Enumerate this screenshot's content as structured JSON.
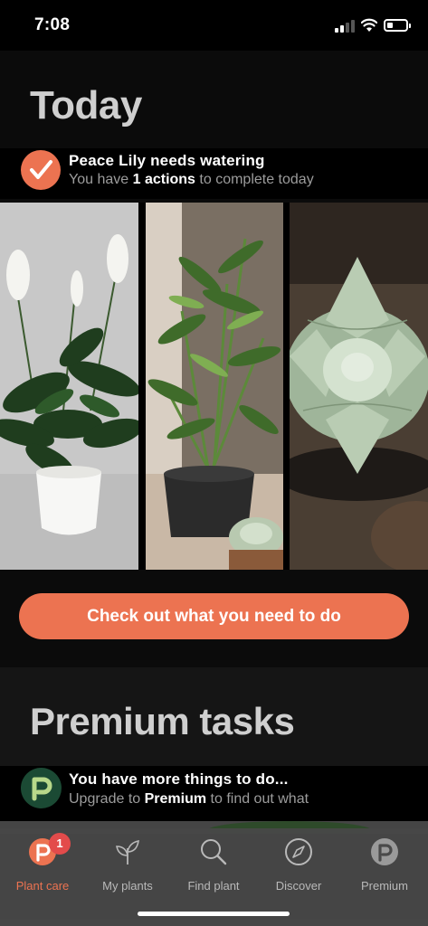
{
  "status_bar": {
    "time": "7:08"
  },
  "today": {
    "title": "Today",
    "task": {
      "title": "Peace Lily needs watering",
      "subtitle_prefix": "You have ",
      "subtitle_bold": "1 actions",
      "subtitle_suffix": " to complete today"
    },
    "photos": [
      "peace-lily-photo",
      "palm-plant-photo",
      "succulent-photo"
    ],
    "cta_label": "Check out what you need to do"
  },
  "premium": {
    "title": "Premium tasks",
    "row": {
      "title": "You have more things to do...",
      "subtitle_prefix": "Upgrade to ",
      "subtitle_bold": "Premium",
      "subtitle_suffix": " to find out what"
    }
  },
  "tab_bar": {
    "tabs": [
      {
        "label": "Plant care",
        "icon": "plant-care-icon",
        "badge": "1"
      },
      {
        "label": "My plants",
        "icon": "sprout-icon"
      },
      {
        "label": "Find plant",
        "icon": "search-icon"
      },
      {
        "label": "Discover",
        "icon": "compass-icon"
      },
      {
        "label": "Premium",
        "icon": "premium-p-icon"
      }
    ]
  },
  "colors": {
    "accent": "#ec7351",
    "background": "#0b0b0b",
    "premium_logo": "#1b4a34",
    "badge": "#e34b4b"
  }
}
